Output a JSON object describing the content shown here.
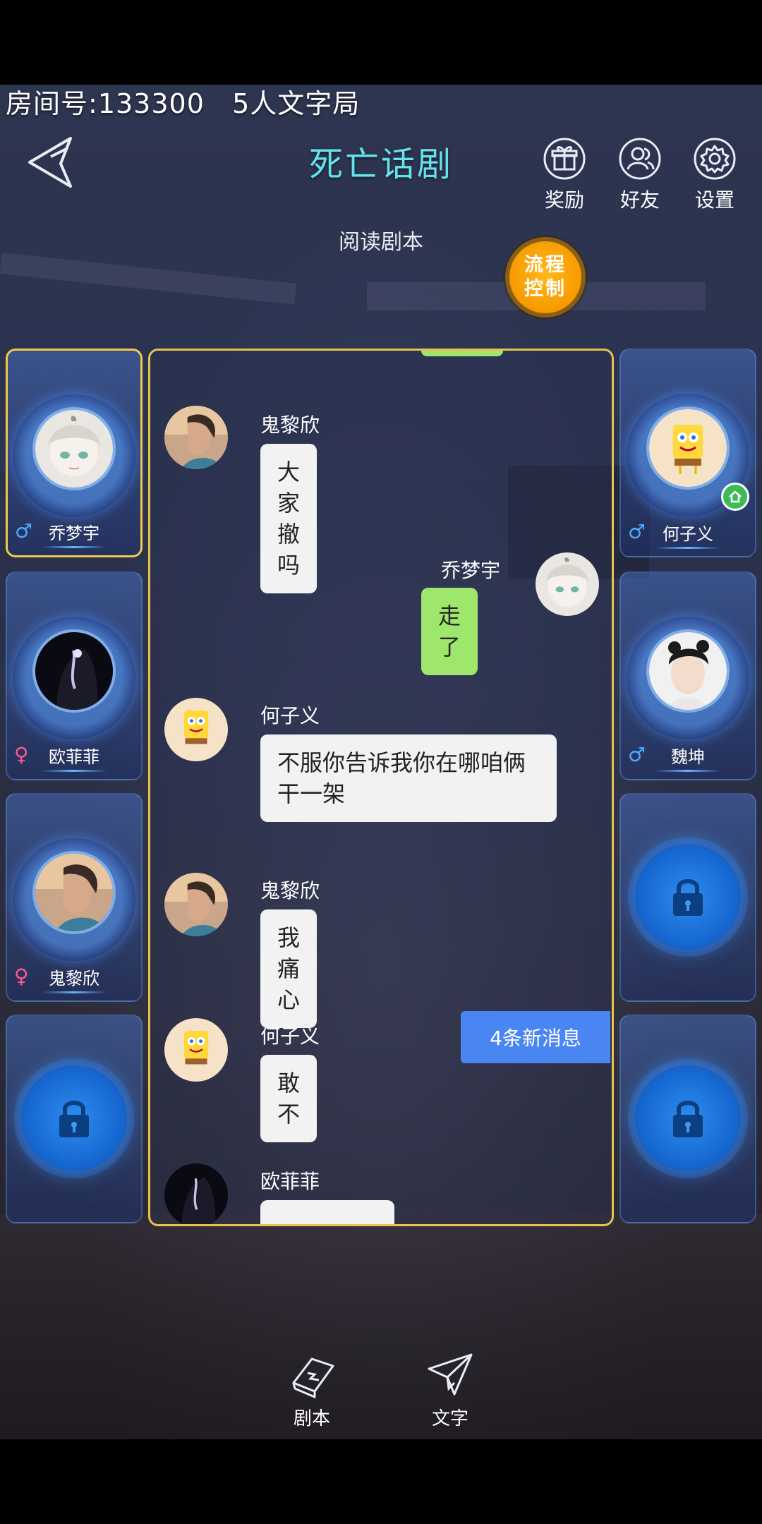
{
  "room": {
    "label": "房间号:",
    "number": "133300",
    "mode": "5人文字局"
  },
  "header": {
    "title": "死亡话剧",
    "actions": [
      {
        "label": "奖励",
        "icon": "gift-icon"
      },
      {
        "label": "好友",
        "icon": "friends-icon"
      },
      {
        "label": "设置",
        "icon": "gear-icon"
      }
    ]
  },
  "phase": "阅读剧本",
  "flow_button": "流程控制",
  "left_slots": [
    {
      "name": "乔梦宇",
      "gender": "♂",
      "gender_color": "#4aa9ff",
      "active": true
    },
    {
      "name": "欧菲菲",
      "gender": "♀",
      "gender_color": "#ff5a8c"
    },
    {
      "name": "鬼黎欣",
      "gender": "♀",
      "gender_color": "#ff5a8c"
    },
    {
      "locked": true
    }
  ],
  "right_slots": [
    {
      "name": "何子义",
      "gender": "♂",
      "gender_color": "#4aa9ff",
      "host": true
    },
    {
      "name": "魏坤",
      "gender": "♂",
      "gender_color": "#4aa9ff"
    },
    {
      "locked": true
    },
    {
      "locked": true
    }
  ],
  "messages": [
    {
      "sender": "鬼黎欣",
      "text": "大家撤吗"
    },
    {
      "sender": "乔梦宇",
      "text": "走了",
      "mine": true
    },
    {
      "sender": "何子义",
      "text": "不服你告诉我你在哪咱俩干一架"
    },
    {
      "sender": "鬼黎欣",
      "text": "我痛心"
    },
    {
      "sender": "何子义",
      "text": "敢不"
    },
    {
      "sender": "欧菲菲",
      "text": ""
    }
  ],
  "new_messages": "4条新消息",
  "bottom": {
    "script": "剧本",
    "text": "文字"
  }
}
